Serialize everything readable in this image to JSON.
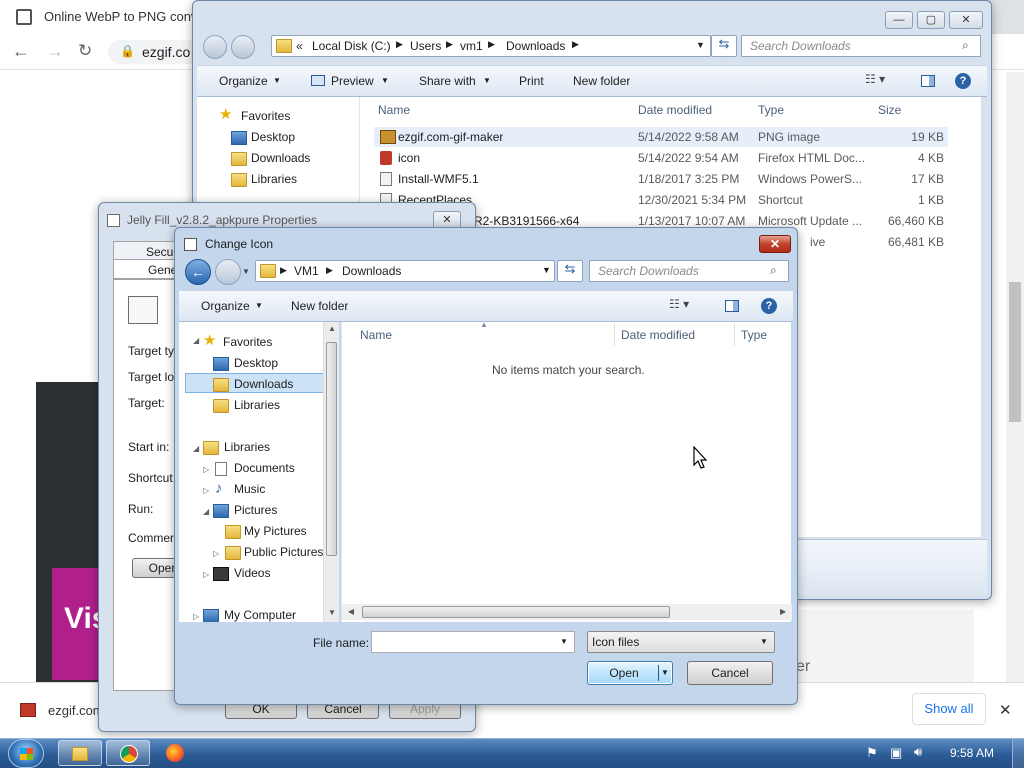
{
  "browser": {
    "tab_title": "Online WebP to PNG conver",
    "address": "ezgif.co",
    "banner_text": "Vis",
    "right_text": "er",
    "download": {
      "item": "ezgif.com",
      "show_all": "Show all",
      "close": "✕"
    }
  },
  "taskbar": {
    "time": "9:58 AM"
  },
  "explorer": {
    "breadcrumb": {
      "root": "«",
      "items": [
        "Local Disk (C:)",
        "Users",
        "vm1",
        "Downloads"
      ]
    },
    "search_placeholder": "Search Downloads",
    "toolbar": {
      "organize": "Organize",
      "preview": "Preview",
      "share_with": "Share with",
      "print": "Print",
      "new_folder": "New folder"
    },
    "nav": {
      "favorites": "Favorites",
      "items": [
        "Desktop",
        "Downloads",
        "Libraries"
      ]
    },
    "columns": {
      "name": "Name",
      "date": "Date modified",
      "type": "Type",
      "size": "Size"
    },
    "files": [
      {
        "name": "ezgif.com-gif-maker",
        "date": "5/14/2022 9:58 AM",
        "type": "PNG image",
        "size": "19 KB"
      },
      {
        "name": "icon",
        "date": "5/14/2022 9:54 AM",
        "type": "Firefox HTML Doc...",
        "size": "4 KB"
      },
      {
        "name": "Install-WMF5.1",
        "date": "1/18/2017 3:25 PM",
        "type": "Windows PowerS...",
        "size": "17 KB"
      },
      {
        "name": "RecentPlaces",
        "date": "12/30/2021 5:34 PM",
        "type": "Shortcut",
        "size": "1 KB"
      },
      {
        "name": "R2-KB3191566-x64",
        "date": "1/13/2017 10:07 AM",
        "type": "Microsoft Update ...",
        "size": "66,460 KB"
      },
      {
        "name": "",
        "date": "",
        "type": "ive",
        "size": "66,481 KB"
      }
    ]
  },
  "properties": {
    "title": "Jelly Fill_v2.8.2_apkpure Properties",
    "tabs": [
      "Secur",
      "Gene"
    ],
    "labels": [
      "Target ty",
      "Target lo",
      "Target:",
      "Start in:",
      "Shortcut",
      "Run:",
      "Commen"
    ],
    "open_button": "Oper",
    "ok": "OK",
    "cancel": "Cancel",
    "apply": "Apply"
  },
  "change_icon": {
    "title": "Change Icon",
    "breadcrumb": [
      "VM1",
      "Downloads"
    ],
    "search_placeholder": "Search Downloads",
    "toolbar": {
      "organize": "Organize",
      "new_folder": "New folder"
    },
    "tree": {
      "favorites": "Favorites",
      "desktop": "Desktop",
      "downloads": "Downloads",
      "libraries": "Libraries",
      "libraries_group": "Libraries",
      "documents": "Documents",
      "music": "Music",
      "pictures": "Pictures",
      "my_pictures": "My Pictures",
      "public_pictures": "Public Pictures",
      "videos": "Videos",
      "my_computer": "My Computer"
    },
    "columns": {
      "name": "Name",
      "date": "Date modified",
      "type": "Type"
    },
    "empty_message": "No items match your search.",
    "filename_label": "File name:",
    "filename_value": "",
    "filetype": "Icon files",
    "open_button": "Open",
    "cancel_button": "Cancel"
  }
}
